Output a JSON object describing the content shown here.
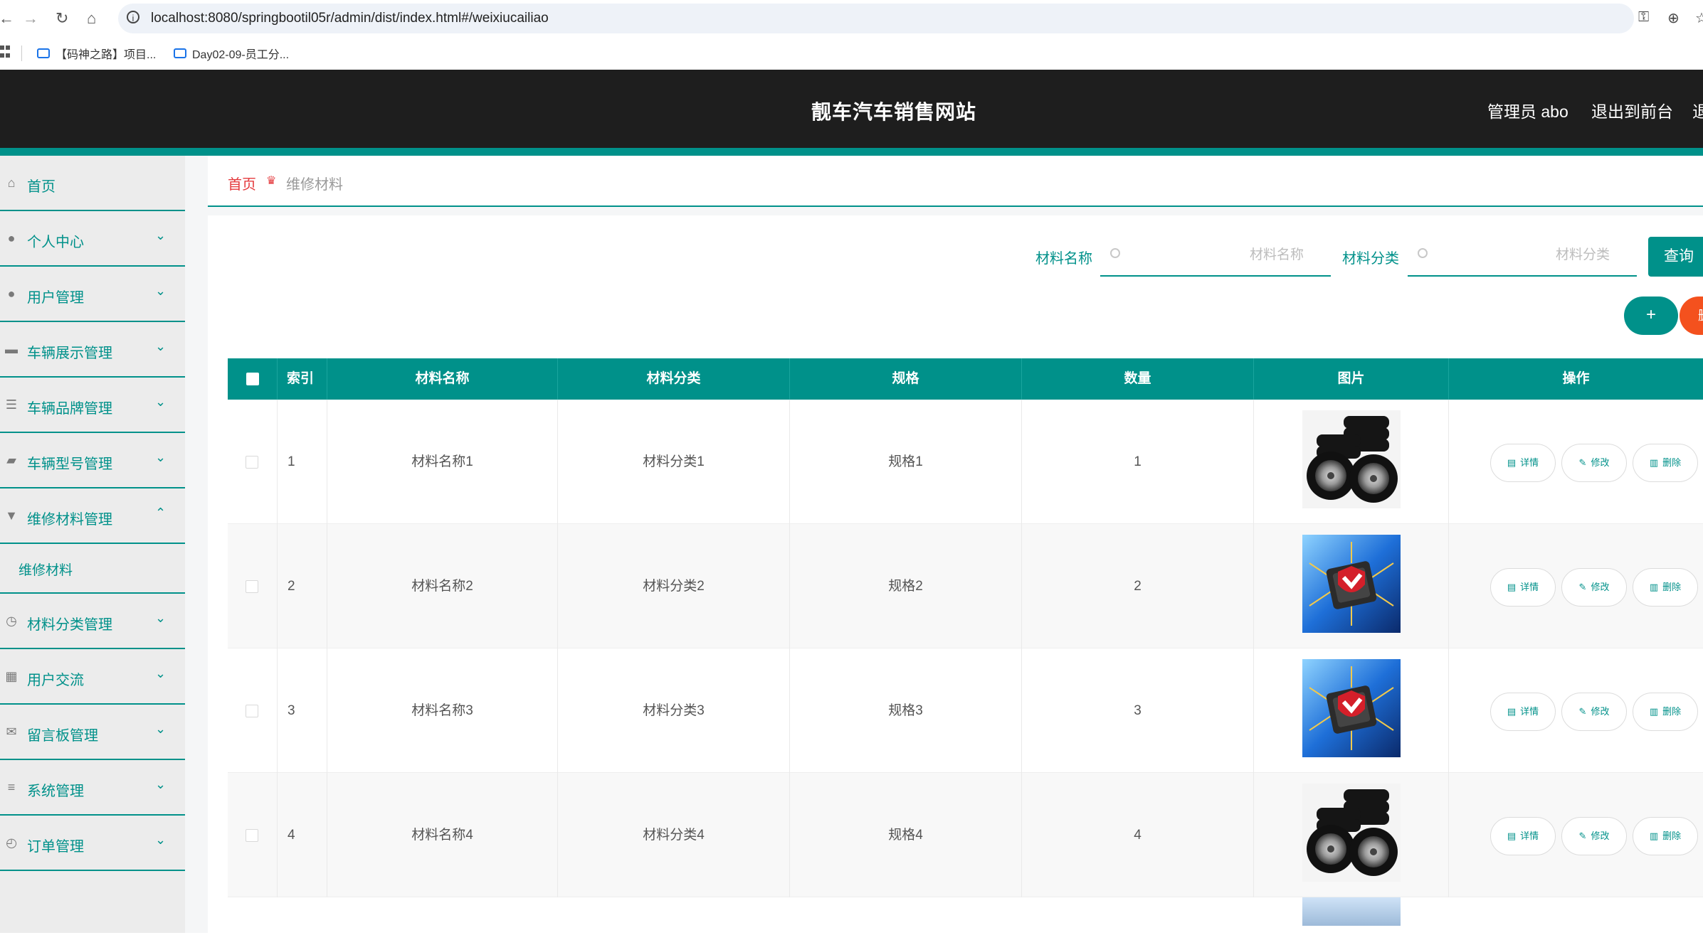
{
  "browser": {
    "url": "localhost:8080/springbootil05r/admin/dist/index.html#/weixiucailiao",
    "bookmarks": [
      "【码神之路】项目...",
      "Day02-09-员工分..."
    ]
  },
  "header": {
    "title": "靓车汽车销售网站",
    "admin": "管理员 abo",
    "exit_front": "退出到前台",
    "exit_partial": "退"
  },
  "sidebar": {
    "items": [
      {
        "label": "首页",
        "icon": "home-icon"
      },
      {
        "label": "个人中心",
        "icon": "user-icon"
      },
      {
        "label": "用户管理",
        "icon": "user-icon"
      },
      {
        "label": "车辆展示管理",
        "icon": "monitor-icon"
      },
      {
        "label": "车辆品牌管理",
        "icon": "sliders-icon"
      },
      {
        "label": "车辆型号管理",
        "icon": "wallet-icon"
      },
      {
        "label": "维修材料管理",
        "icon": "brush-icon"
      },
      {
        "label": "材料分类管理",
        "icon": "clock-icon"
      },
      {
        "label": "用户交流",
        "icon": "grid-icon"
      },
      {
        "label": "留言板管理",
        "icon": "ticket-icon"
      },
      {
        "label": "系统管理",
        "icon": "list-icon"
      },
      {
        "label": "订单管理",
        "icon": "compass-icon"
      }
    ],
    "sub_item": "维修材料"
  },
  "breadcrumb": {
    "home": "首页",
    "current": "维修材料"
  },
  "search": {
    "name_label": "材料名称",
    "name_placeholder": "材料名称",
    "category_label": "材料分类",
    "category_placeholder": "材料分类",
    "query_button": "查询"
  },
  "actions": {
    "add": "+",
    "delete_partial": "删"
  },
  "table": {
    "headers": [
      "索引",
      "材料名称",
      "材料分类",
      "规格",
      "数量",
      "图片",
      "操作"
    ],
    "op_labels": {
      "detail": "详情",
      "edit": "修改",
      "delete": "删除"
    },
    "rows": [
      {
        "index": "1",
        "name": "材料名称1",
        "category": "材料分类1",
        "spec": "规格1",
        "qty": "1",
        "image": "tires"
      },
      {
        "index": "2",
        "name": "材料名称2",
        "category": "材料分类2",
        "spec": "规格2",
        "qty": "2",
        "image": "chip"
      },
      {
        "index": "3",
        "name": "材料名称3",
        "category": "材料分类3",
        "spec": "规格3",
        "qty": "3",
        "image": "chip"
      },
      {
        "index": "4",
        "name": "材料名称4",
        "category": "材料分类4",
        "spec": "规格4",
        "qty": "4",
        "image": "tires"
      }
    ]
  },
  "colors": {
    "accent": "#00918a",
    "header_bg": "#1e1e1e",
    "danger": "#f4511e",
    "breadcrumb_home": "#e4393c"
  }
}
